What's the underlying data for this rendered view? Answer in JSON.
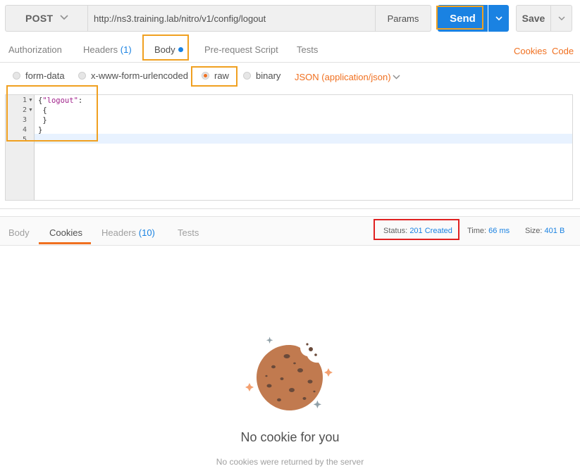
{
  "request": {
    "method": "POST",
    "url": "http://ns3.training.lab/nitro/v1/config/logout",
    "params_label": "Params",
    "send_label": "Send",
    "save_label": "Save"
  },
  "request_tabs": {
    "authorization": "Authorization",
    "headers": "Headers",
    "headers_count": "(1)",
    "body": "Body",
    "pre_request": "Pre-request Script",
    "tests": "Tests",
    "cookies_link": "Cookies",
    "code_link": "Code"
  },
  "body_types": {
    "form_data": "form-data",
    "urlencoded": "x-www-form-urlencoded",
    "raw": "raw",
    "binary": "binary",
    "selected": "raw",
    "content_type": "JSON (application/json)"
  },
  "editor": {
    "line_numbers": [
      "1",
      "2",
      "3",
      "4",
      "5"
    ],
    "line1_punct_open": "{",
    "line1_key": "\"logout\"",
    "line1_punct_close": ":",
    "line2": " {",
    "line3": " }",
    "line4": "}",
    "line5": ""
  },
  "response_tabs": {
    "body": "Body",
    "cookies": "Cookies",
    "headers": "Headers",
    "headers_count": "(10)",
    "tests": "Tests",
    "active": "Cookies"
  },
  "response_meta": {
    "status_label": "Status:",
    "status_value": "201 Created",
    "time_label": "Time:",
    "time_value": "66 ms",
    "size_label": "Size:",
    "size_value": "401 B"
  },
  "empty_state": {
    "title": "No cookie for you",
    "subtitle": "No cookies were returned by the server"
  },
  "colors": {
    "accent_blue": "#1a82e2",
    "accent_orange": "#f07020",
    "highlight_orange": "#f0a020",
    "highlight_red": "#e02020",
    "cookie": "#c17a4f"
  }
}
